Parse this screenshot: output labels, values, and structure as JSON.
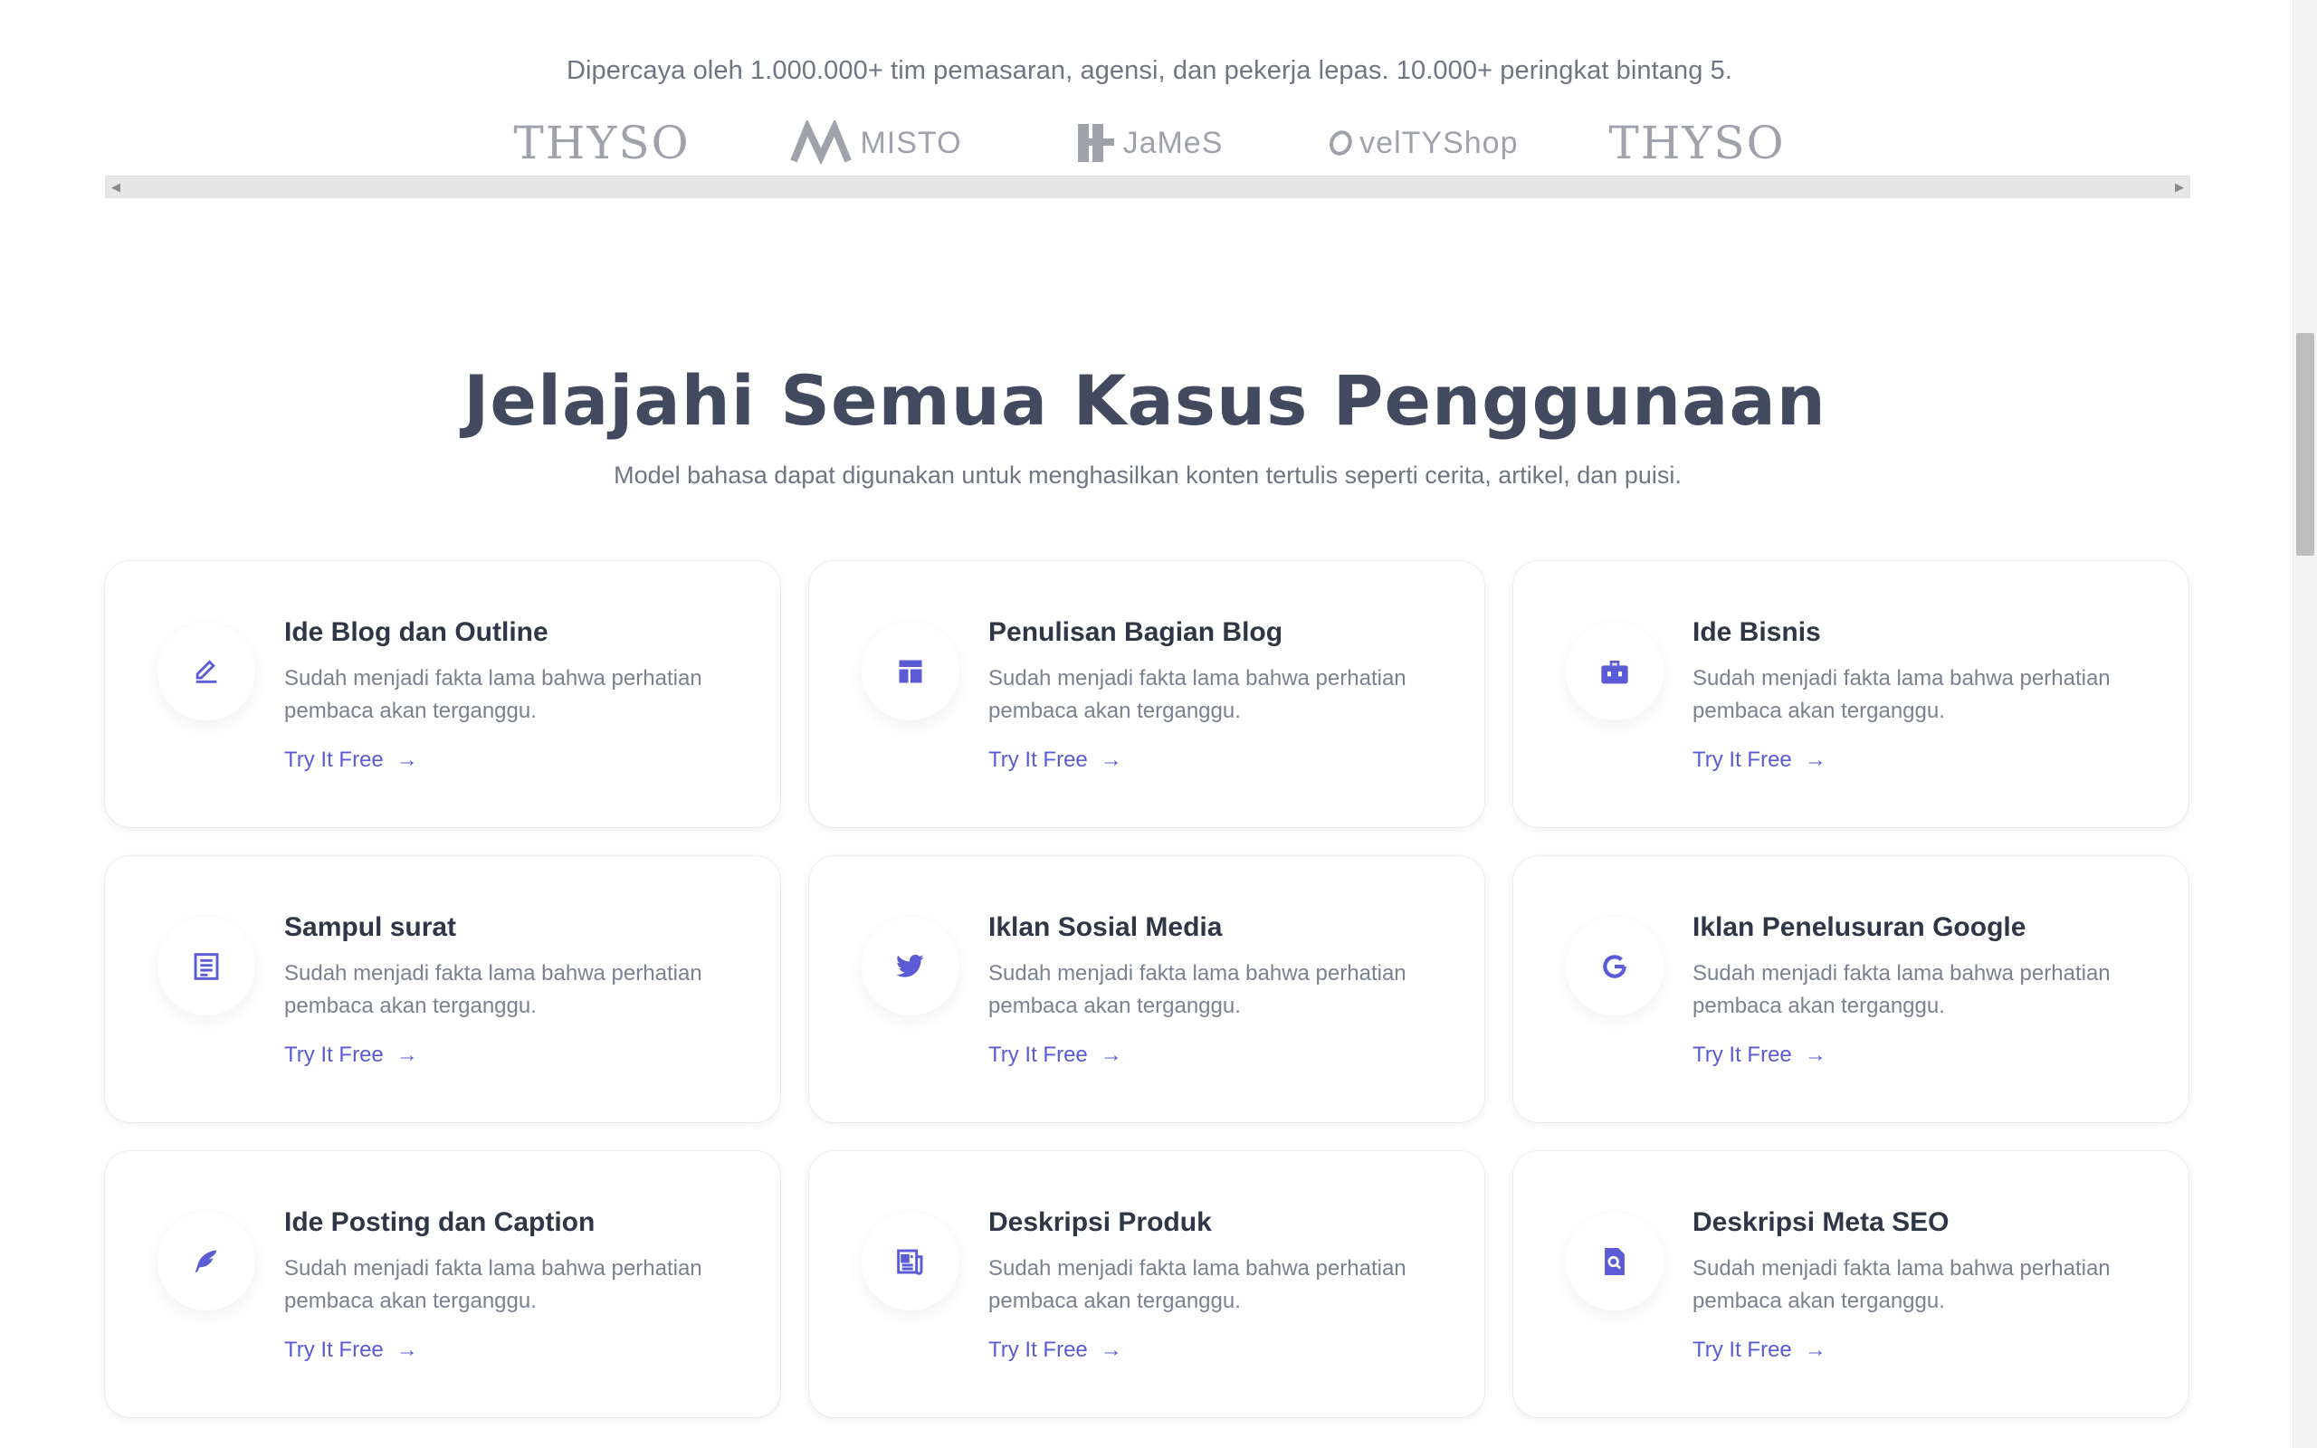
{
  "trust_text": "Dipercaya oleh 1.000.000+ tim pemasaran, agensi, dan pekerja lepas. 10.000+ peringkat bintang 5.",
  "logos": [
    "THYSO",
    "MISTO",
    "JaMeS",
    "velTYShop",
    "THYSO"
  ],
  "section": {
    "title": "Jelajahi Semua Kasus Penggunaan",
    "subtitle": "Model bahasa dapat digunakan untuk menghasilkan konten tertulis seperti cerita, artikel, dan puisi."
  },
  "cards": [
    {
      "title": "Ide Blog dan Outline",
      "desc": "Sudah menjadi fakta lama bahwa perhatian pembaca akan terganggu.",
      "link": "Try It Free",
      "icon": "pencil-icon"
    },
    {
      "title": "Penulisan Bagian Blog",
      "desc": "Sudah menjadi fakta lama bahwa perhatian pembaca akan terganggu.",
      "link": "Try It Free",
      "icon": "layout-icon"
    },
    {
      "title": "Ide Bisnis",
      "desc": "Sudah menjadi fakta lama bahwa perhatian pembaca akan terganggu.",
      "link": "Try It Free",
      "icon": "briefcase-icon"
    },
    {
      "title": "Sampul surat",
      "desc": "Sudah menjadi fakta lama bahwa perhatian pembaca akan terganggu.",
      "link": "Try It Free",
      "icon": "document-icon"
    },
    {
      "title": "Iklan Sosial Media",
      "desc": "Sudah menjadi fakta lama bahwa perhatian pembaca akan terganggu.",
      "link": "Try It Free",
      "icon": "twitter-icon"
    },
    {
      "title": "Iklan Penelusuran Google",
      "desc": "Sudah menjadi fakta lama bahwa perhatian pembaca akan terganggu.",
      "link": "Try It Free",
      "icon": "google-icon"
    },
    {
      "title": "Ide Posting dan Caption",
      "desc": "Sudah menjadi fakta lama bahwa perhatian pembaca akan terganggu.",
      "link": "Try It Free",
      "icon": "feather-icon"
    },
    {
      "title": "Deskripsi Produk",
      "desc": "Sudah menjadi fakta lama bahwa perhatian pembaca akan terganggu.",
      "link": "Try It Free",
      "icon": "newspaper-icon"
    },
    {
      "title": "Deskripsi Meta SEO",
      "desc": "Sudah menjadi fakta lama bahwa perhatian pembaca akan terganggu.",
      "link": "Try It Free",
      "icon": "search-file-icon"
    }
  ],
  "colors": {
    "accent": "#5b5bd6",
    "heading": "#414a5e",
    "muted": "#6e7583"
  }
}
